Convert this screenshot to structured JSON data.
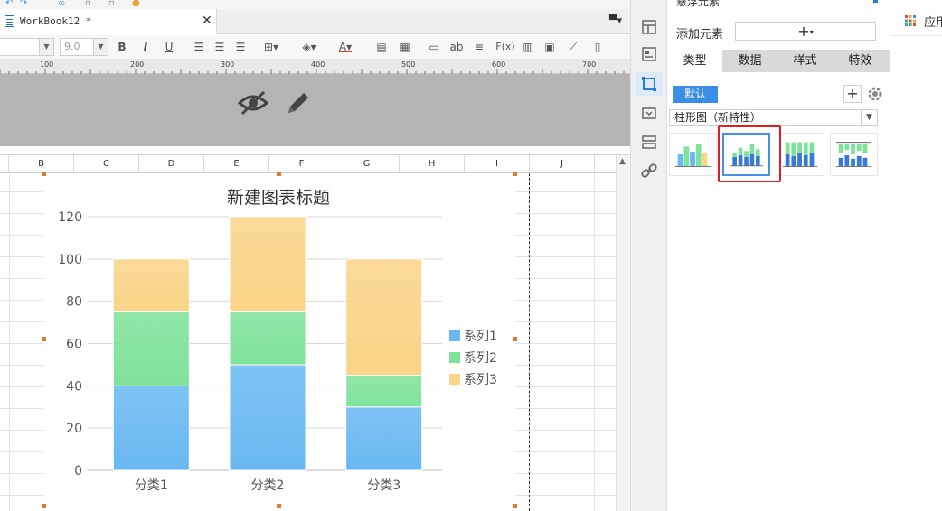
{
  "window": {
    "tab_title": "WorkBook12 *"
  },
  "toolbar": {
    "font_size_value": "9.0",
    "bold_label": "B",
    "italic_label": "I",
    "underline_label": "U",
    "text_label": "ab",
    "formula_label": "F(x)"
  },
  "ruler": {
    "ticks": [
      "100",
      "200",
      "300",
      "400",
      "500",
      "600",
      "700"
    ]
  },
  "sheet": {
    "columns": [
      "B",
      "C",
      "D",
      "E",
      "F",
      "G",
      "H",
      "I",
      "J"
    ]
  },
  "right_panel": {
    "title": "悬浮元素",
    "add_element_label": "添加元素",
    "add_element_value": "+",
    "tabs": [
      "类型",
      "数据",
      "样式",
      "特效"
    ],
    "active_tab": "类型",
    "default_button": "默认",
    "add_button": "+",
    "chart_type_value": "柱形图（新特性）",
    "thumbnails": [
      {
        "name": "clustered-bar",
        "selected": false
      },
      {
        "name": "stacked-bar",
        "selected": true
      },
      {
        "name": "percent-stacked-bar",
        "selected": false
      },
      {
        "name": "custom-stacked-bar",
        "selected": false
      }
    ]
  },
  "app_bar": {
    "label": "应用"
  },
  "colors": {
    "series1": "#69b8f2",
    "series2": "#7fe29a",
    "series3": "#fad487",
    "highlight_red": "#e02020",
    "accent_blue": "#3a8ee6"
  },
  "chart_data": {
    "type": "bar",
    "stacked": true,
    "title": "新建图表标题",
    "categories": [
      "分类1",
      "分类2",
      "分类3"
    ],
    "series": [
      {
        "name": "系列1",
        "values": [
          40,
          50,
          30
        ]
      },
      {
        "name": "系列2",
        "values": [
          35,
          25,
          15
        ]
      },
      {
        "name": "系列3",
        "values": [
          25,
          45,
          55
        ]
      }
    ],
    "ylim": [
      0,
      120
    ],
    "yticks": [
      0,
      20,
      40,
      60,
      80,
      100,
      120
    ],
    "grid": true,
    "legend": "right"
  }
}
